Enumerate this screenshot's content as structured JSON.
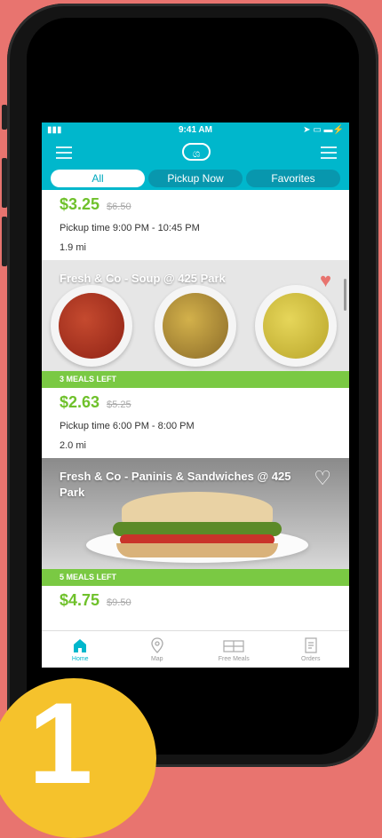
{
  "status_bar": {
    "time": "9:41 AM"
  },
  "tabs": [
    {
      "label": "All",
      "active": true
    },
    {
      "label": "Pickup Now",
      "active": false
    },
    {
      "label": "Favorites",
      "active": false
    }
  ],
  "listings": [
    {
      "price": "$3.25",
      "original_price": "$6.50",
      "pickup": "Pickup time  9:00 PM - 10:45 PM",
      "distance": "1.9 mi"
    },
    {
      "title": "Fresh & Co - Soup @ 425 Park",
      "meals_left": "3 MEALS LEFT",
      "price": "$2.63",
      "original_price": "$5.25",
      "pickup": "Pickup time  6:00 PM - 8:00 PM",
      "distance": "2.0 mi",
      "favorited": true
    },
    {
      "title": "Fresh & Co - Paninis & Sandwiches @ 425 Park",
      "meals_left": "5 MEALS LEFT",
      "price": "$4.75",
      "original_price": "$9.50",
      "favorited": false
    }
  ],
  "bottom_nav": [
    {
      "label": "Home",
      "icon": "home-icon",
      "active": true
    },
    {
      "label": "Map",
      "icon": "map-pin-icon"
    },
    {
      "label": "Free Meals",
      "icon": "gift-icon"
    },
    {
      "label": "Orders",
      "icon": "receipt-icon"
    }
  ],
  "step_badge": "1",
  "colors": {
    "brand": "#00b7cc",
    "price_green": "#6fc12b",
    "banner_green": "#7ac943",
    "background": "#e8746f",
    "badge": "#f5c22c"
  }
}
